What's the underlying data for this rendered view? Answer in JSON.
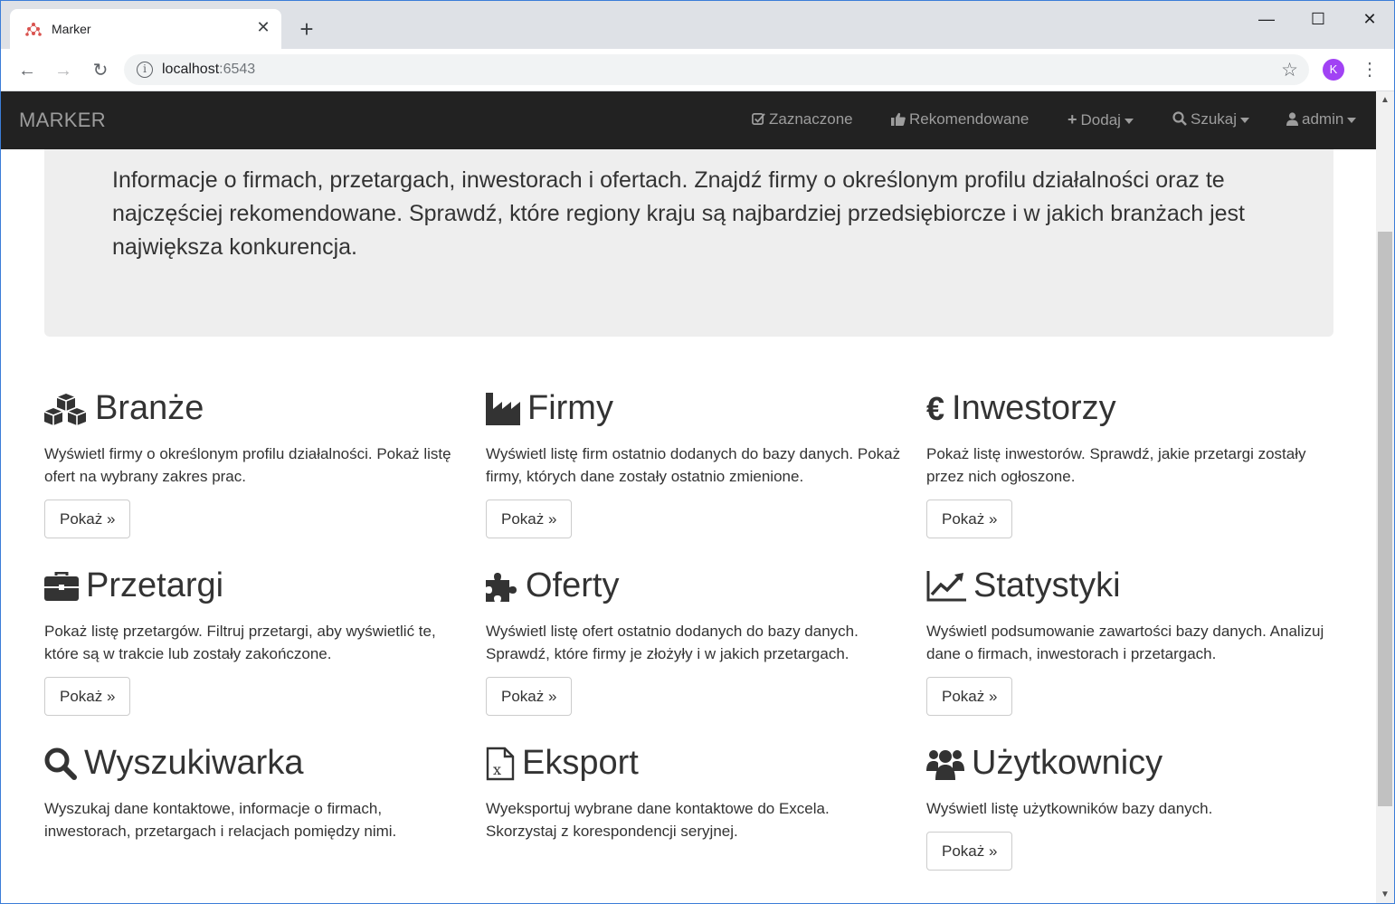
{
  "browser": {
    "tab_title": "Marker",
    "url_host": "localhost",
    "url_port": ":6543",
    "profile_initial": "K"
  },
  "navbar": {
    "brand": "MARKER",
    "items": [
      {
        "label": "Zaznaczone",
        "icon": "check-square-icon"
      },
      {
        "label": "Rekomendowane",
        "icon": "thumbs-up-icon"
      },
      {
        "label": "Dodaj",
        "icon": "plus-icon"
      },
      {
        "label": "Szukaj",
        "icon": "search-icon"
      },
      {
        "label": "admin",
        "icon": "user-icon"
      }
    ]
  },
  "jumbotron": {
    "text": "Informacje o firmach, przetargach, inwestorach i ofertach. Znajdź firmy o określonym profilu działalności oraz te najczęściej rekomendowane. Sprawdź, które regiony kraju są najbardziej przedsiębiorcze i w jakich branżach jest największa konkurencja."
  },
  "cards": [
    {
      "title": "Branże",
      "icon": "cubes-icon",
      "description": "Wyświetl firmy o określonym profilu działalności. Pokaż listę ofert na wybrany zakres prac.",
      "button": "Pokaż »"
    },
    {
      "title": "Firmy",
      "icon": "industry-icon",
      "description": "Wyświetl listę firm ostatnio dodanych do bazy danych. Pokaż firmy, których dane zostały ostatnio zmienione.",
      "button": "Pokaż »"
    },
    {
      "title": "Inwestorzy",
      "icon": "euro-icon",
      "description": "Pokaż listę inwestorów. Sprawdź, jakie przetargi zostały przez nich ogłoszone.",
      "button": "Pokaż »"
    },
    {
      "title": "Przetargi",
      "icon": "briefcase-icon",
      "description": "Pokaż listę przetargów. Filtruj przetargi, aby wyświetlić te, które są w trakcie lub zostały zakończone.",
      "button": "Pokaż »"
    },
    {
      "title": "Oferty",
      "icon": "puzzle-icon",
      "description": "Wyświetl listę ofert ostatnio dodanych do bazy danych. Sprawdź, które firmy je złożyły i w jakich przetargach.",
      "button": "Pokaż »"
    },
    {
      "title": "Statystyki",
      "icon": "line-chart-icon",
      "description": "Wyświetl podsumowanie zawartości bazy danych. Analizuj dane o firmach, inwestorach i przetargach.",
      "button": "Pokaż »"
    },
    {
      "title": "Wyszukiwarka",
      "icon": "search-icon",
      "description": "Wyszukaj dane kontaktowe, informacje o firmach, inwestorach, przetargach i relacjach pomiędzy nimi.",
      "button": ""
    },
    {
      "title": "Eksport",
      "icon": "file-excel-icon",
      "description": "Wyeksportuj wybrane dane kontaktowe do Excela. Skorzystaj z korespondencji seryjnej.",
      "button": ""
    },
    {
      "title": "Użytkownicy",
      "icon": "users-icon",
      "description": "Wyświetl listę użytkowników bazy danych.",
      "button": "Pokaż »"
    }
  ]
}
